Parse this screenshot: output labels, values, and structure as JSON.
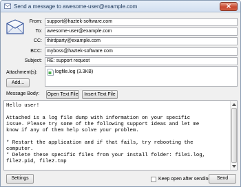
{
  "window": {
    "title": "Send a message to  awesome-user@example.com",
    "close_label": "✕"
  },
  "fields": {
    "from": {
      "label": "From:",
      "value": "support@haztek-software.com"
    },
    "to": {
      "label": "To:",
      "value": "awesome-user@example.com"
    },
    "cc": {
      "label": "CC:",
      "value": "thirdparty@example.com"
    },
    "bcc": {
      "label": "BCC:",
      "value": "myboss@haztek-software.com"
    },
    "subject": {
      "label": "Subject:",
      "value": "RE: support request"
    }
  },
  "attachments": {
    "label": "Attachment(s):",
    "add_button": "Add...",
    "items": [
      {
        "label": "logfile.log (3.3KB)"
      }
    ]
  },
  "message_body": {
    "label": "Message Body:",
    "open_button": "Open Text File",
    "insert_button": "Insert Text File",
    "text": "Hello user!\n\nAttached is a log file dump with information on your specific\nissue. Please try some of the following support ideas and let me\nknow if any of them help solve your problem.\n\n* Restart the application and if that fails, try rebooting the\ncomputer.\n* Delete these specific files from your install folder: file1.log,\nfile2.pid, file2.tmp"
  },
  "footer": {
    "settings_button": "Settings",
    "keep_open_label": "Keep open after sending",
    "keep_open_checked": false,
    "send_button": "Send"
  },
  "icons": {
    "title": "envelope-icon",
    "header": "envelope-icon",
    "attachment": "file-attachment-icon"
  },
  "colors": {
    "title_text": "#1e395b",
    "close_button": "#c94a30",
    "envelope_accent": "#3d5a9e"
  }
}
